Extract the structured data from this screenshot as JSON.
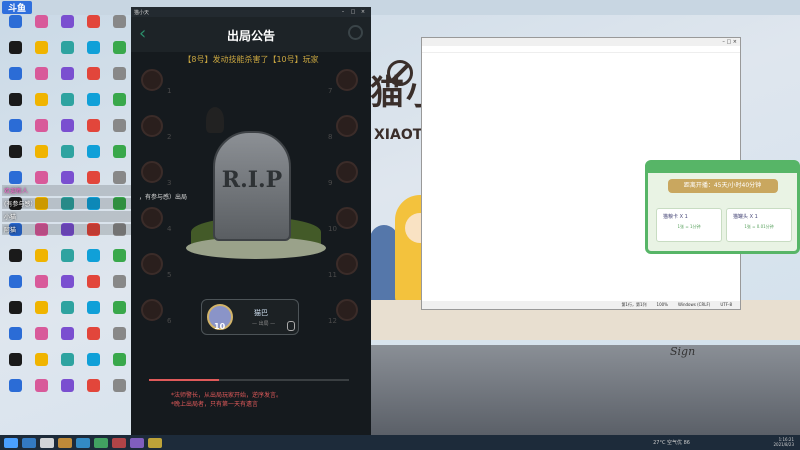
{
  "game_window": {
    "tab_title": "猫小天",
    "header_title": "出局公告",
    "announcement": "【8号】发动技能杀害了【10号】玩家",
    "exit_note": "，有参与感）出局",
    "grave_text": "R.I.P",
    "player_card": {
      "number": "10",
      "name": "猫巴",
      "subtitle": "— 出局 —"
    },
    "rules": [
      "*法师警长，从出局玩家开始，逆序发言。",
      "*晚上出局者，只有第一天有遗言"
    ],
    "seat_numbers": [
      "1",
      "2",
      "3",
      "4",
      "5",
      "6",
      "7",
      "8",
      "9",
      "10",
      "11",
      "12"
    ]
  },
  "chat": {
    "messages": [
      {
        "user": "欢迎新人",
        "text": ""
      },
      {
        "user": "",
        "text": "(有参与感）"
      },
      {
        "user": "",
        "text": "小猫"
      },
      {
        "user": "",
        "text": "阿猫"
      }
    ]
  },
  "notepad": {
    "status_items": [
      "第1行，第1列",
      "100%",
      "Windows (CRLF)",
      "UTF-8"
    ]
  },
  "popup": {
    "banner": "距离开播：45天/小时40分钟",
    "box_left": {
      "item": "猫粮卡 X 1",
      "count": "1张 = 1分钟"
    },
    "box_right": {
      "item": "猫罐头 X 1",
      "count": "1张 = 0.01分钟"
    }
  },
  "taskbar": {
    "weather": "27°C 空气优 86",
    "time": "1:16:21",
    "date": "2021/8/23"
  },
  "colors": {
    "accent_green": "#57b567",
    "announce_gold": "#c9a640",
    "rule_red": "#e05a5a"
  }
}
